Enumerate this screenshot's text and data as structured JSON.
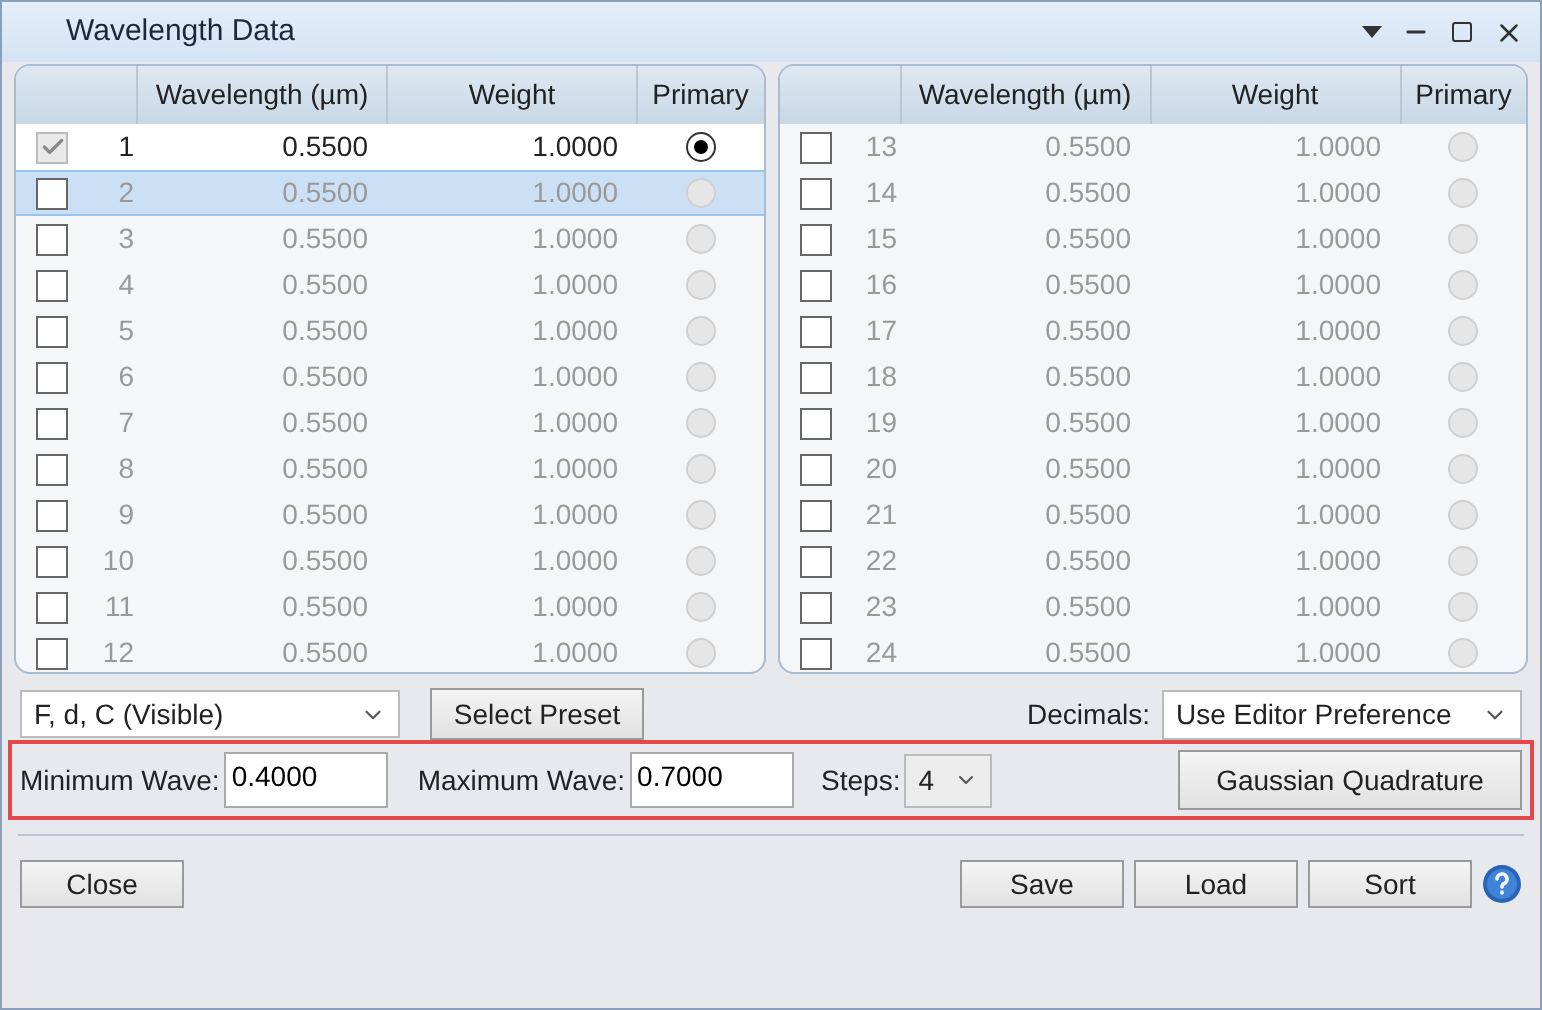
{
  "window": {
    "title": "Wavelength Data"
  },
  "tables": [
    {
      "columns": [
        "Wavelength (µm)",
        "Weight",
        "Primary"
      ],
      "rows": [
        {
          "number": "1",
          "wavelength": "0.5500",
          "weight": "1.0000",
          "checked": true,
          "selected": false,
          "primary": true
        },
        {
          "number": "2",
          "wavelength": "0.5500",
          "weight": "1.0000",
          "checked": false,
          "selected": true,
          "primary": false
        },
        {
          "number": "3",
          "wavelength": "0.5500",
          "weight": "1.0000",
          "checked": false,
          "selected": false,
          "primary": false
        },
        {
          "number": "4",
          "wavelength": "0.5500",
          "weight": "1.0000",
          "checked": false,
          "selected": false,
          "primary": false
        },
        {
          "number": "5",
          "wavelength": "0.5500",
          "weight": "1.0000",
          "checked": false,
          "selected": false,
          "primary": false
        },
        {
          "number": "6",
          "wavelength": "0.5500",
          "weight": "1.0000",
          "checked": false,
          "selected": false,
          "primary": false
        },
        {
          "number": "7",
          "wavelength": "0.5500",
          "weight": "1.0000",
          "checked": false,
          "selected": false,
          "primary": false
        },
        {
          "number": "8",
          "wavelength": "0.5500",
          "weight": "1.0000",
          "checked": false,
          "selected": false,
          "primary": false
        },
        {
          "number": "9",
          "wavelength": "0.5500",
          "weight": "1.0000",
          "checked": false,
          "selected": false,
          "primary": false
        },
        {
          "number": "10",
          "wavelength": "0.5500",
          "weight": "1.0000",
          "checked": false,
          "selected": false,
          "primary": false
        },
        {
          "number": "11",
          "wavelength": "0.5500",
          "weight": "1.0000",
          "checked": false,
          "selected": false,
          "primary": false
        },
        {
          "number": "12",
          "wavelength": "0.5500",
          "weight": "1.0000",
          "checked": false,
          "selected": false,
          "primary": false
        }
      ]
    },
    {
      "columns": [
        "Wavelength (µm)",
        "Weight",
        "Primary"
      ],
      "rows": [
        {
          "number": "13",
          "wavelength": "0.5500",
          "weight": "1.0000",
          "checked": false,
          "selected": false,
          "primary": false
        },
        {
          "number": "14",
          "wavelength": "0.5500",
          "weight": "1.0000",
          "checked": false,
          "selected": false,
          "primary": false
        },
        {
          "number": "15",
          "wavelength": "0.5500",
          "weight": "1.0000",
          "checked": false,
          "selected": false,
          "primary": false
        },
        {
          "number": "16",
          "wavelength": "0.5500",
          "weight": "1.0000",
          "checked": false,
          "selected": false,
          "primary": false
        },
        {
          "number": "17",
          "wavelength": "0.5500",
          "weight": "1.0000",
          "checked": false,
          "selected": false,
          "primary": false
        },
        {
          "number": "18",
          "wavelength": "0.5500",
          "weight": "1.0000",
          "checked": false,
          "selected": false,
          "primary": false
        },
        {
          "number": "19",
          "wavelength": "0.5500",
          "weight": "1.0000",
          "checked": false,
          "selected": false,
          "primary": false
        },
        {
          "number": "20",
          "wavelength": "0.5500",
          "weight": "1.0000",
          "checked": false,
          "selected": false,
          "primary": false
        },
        {
          "number": "21",
          "wavelength": "0.5500",
          "weight": "1.0000",
          "checked": false,
          "selected": false,
          "primary": false
        },
        {
          "number": "22",
          "wavelength": "0.5500",
          "weight": "1.0000",
          "checked": false,
          "selected": false,
          "primary": false
        },
        {
          "number": "23",
          "wavelength": "0.5500",
          "weight": "1.0000",
          "checked": false,
          "selected": false,
          "primary": false
        },
        {
          "number": "24",
          "wavelength": "0.5500",
          "weight": "1.0000",
          "checked": false,
          "selected": false,
          "primary": false
        }
      ]
    }
  ],
  "preset": {
    "value": "F, d, C (Visible)",
    "button": "Select Preset"
  },
  "decimals": {
    "label": "Decimals:",
    "value": "Use Editor Preference"
  },
  "quadrature": {
    "highlighted": true,
    "min_label": "Minimum Wave:",
    "min_value": "0.4000",
    "max_label": "Maximum Wave:",
    "max_value": "0.7000",
    "steps_label": "Steps:",
    "steps_value": "4",
    "button": "Gaussian Quadrature"
  },
  "footer": {
    "close": "Close",
    "buttons": [
      "Save",
      "Load",
      "Sort"
    ]
  }
}
